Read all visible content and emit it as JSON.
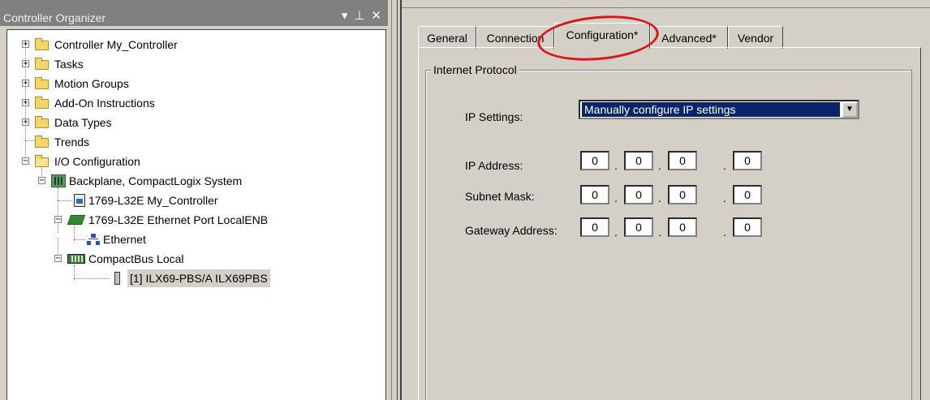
{
  "organizer": {
    "title": "Controller Organizer",
    "controls": [
      "▾",
      "⊥",
      "✕"
    ],
    "tree": {
      "controller": "Controller My_Controller",
      "tasks": "Tasks",
      "motion_groups": "Motion Groups",
      "add_on_instructions": "Add-On Instructions",
      "data_types": "Data Types",
      "trends": "Trends",
      "io_configuration": "I/O Configuration",
      "backplane": "Backplane, CompactLogix System",
      "controller_module": "1769-L32E My_Controller",
      "ethernet_port": "1769-L32E Ethernet Port LocalENB",
      "ethernet": "Ethernet",
      "compactbus": "CompactBus Local",
      "module": "[1] ILX69-PBS/A ILX69PBS"
    }
  },
  "props": {
    "tabs": [
      {
        "label": "General"
      },
      {
        "label": "Connection"
      },
      {
        "label": "Configuration*"
      },
      {
        "label": "Advanced*"
      },
      {
        "label": "Vendor"
      }
    ],
    "active_tab": "Configuration*",
    "group_title": "Internet Protocol",
    "ip_settings_label": "IP Settings:",
    "ip_settings_value": "Manually configure IP settings",
    "dropdown_arrow": "▼",
    "ip_address_label": "IP Address:",
    "subnet_mask_label": "Subnet Mask:",
    "gateway_label": "Gateway Address:",
    "ip_address": [
      "0",
      "0",
      "0",
      "0"
    ],
    "subnet_mask": [
      "0",
      "0",
      "0",
      "0"
    ],
    "gateway": [
      "0",
      "0",
      "0",
      "0"
    ],
    "separator": "."
  },
  "colors": {
    "highlight_circle": "#d81818",
    "selected": "#0a246a",
    "window": "#d4d0c8"
  }
}
